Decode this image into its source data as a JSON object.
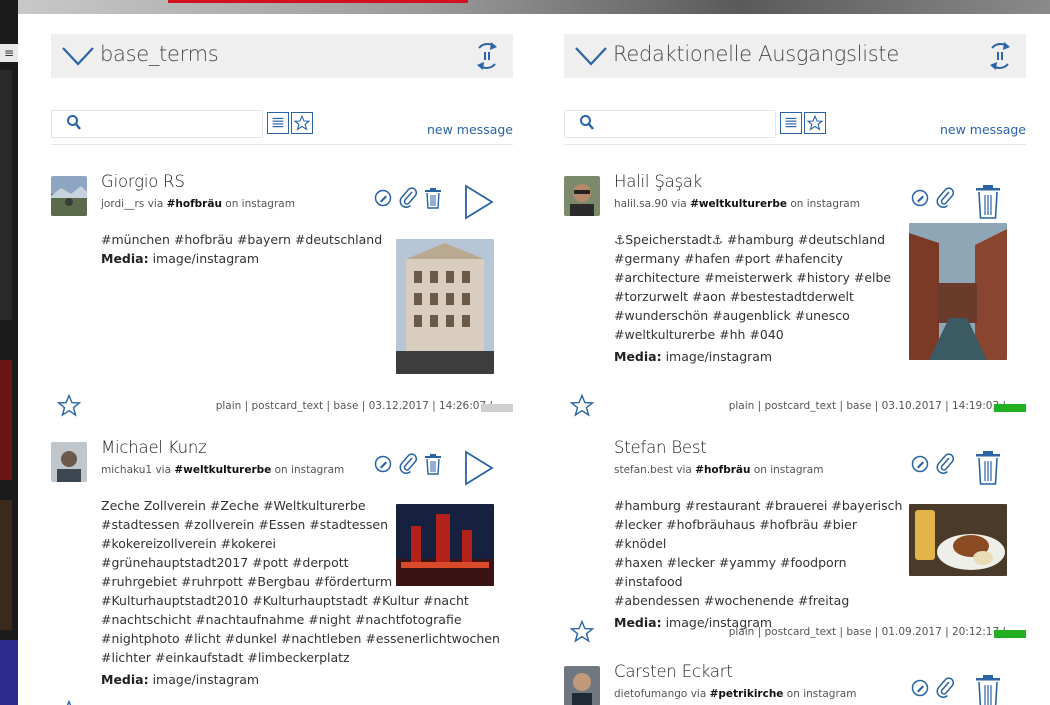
{
  "left_menu_glyph": "≡",
  "columns": [
    {
      "title": "base_terms",
      "search_placeholder": "",
      "new_message": "new message",
      "cards": [
        {
          "name": "Giorgio RS",
          "handle": "jordi__rs",
          "via": "via",
          "tag": "#hofbräu",
          "on": "on instagram",
          "lines": [
            "#münchen #hofbräu #bayern #deutschland"
          ],
          "media_label": "Media:",
          "media_value": "image/instagram",
          "meta": "plain | postcard_text | base | 03.12.2017 | 14:26:07 |",
          "status_color": "#cfcfcf"
        },
        {
          "name": "Michael Kunz",
          "handle": "michaku1",
          "via": "via",
          "tag": "#weltkulturerbe",
          "on": "on instagram",
          "lines": [
            "Zeche Zollverein #Zeche #Weltkulturerbe",
            "#stadtessen #zollverein #Essen #stadtessen",
            "#kokereizollverein #kokerei",
            "#grünehauptstadt2017 #pott #derpott",
            "#ruhrgebiet #ruhrpott #Bergbau #förderturm",
            "#Kulturhauptstadt2010 #Kulturhauptstadt #Kultur #nacht",
            "#nachtschicht #nachtaufnahme #night #nachtfotografie",
            "#nightphoto #licht #dunkel #nachtleben #essenerlichtwochen",
            "#lichter #einkaufstadt #limbeckerplatz"
          ],
          "media_label": "Media:",
          "media_value": "image/instagram"
        }
      ]
    },
    {
      "title": "Redaktionelle Ausgangsliste",
      "search_placeholder": "",
      "new_message": "new message",
      "cards": [
        {
          "name": "Halil Şaşak",
          "handle": "halil.sa.90",
          "via": "via",
          "tag": "#weltkulturerbe",
          "on": "on instagram",
          "lines": [
            "⚓Speicherstadt⚓ #hamburg #deutschland",
            "#germany #hafen #port #hafencity",
            "#architecture #meisterwerk #history #elbe",
            "#torzurwelt #aon #bestestadtderwelt",
            "#wunderschön #augenblick #unesco",
            "#weltkulturerbe #hh #040"
          ],
          "media_label": "Media:",
          "media_value": "image/instagram",
          "meta": "plain | postcard_text | base | 03.10.2017 | 14:19:03 |",
          "status_color": "#22b022"
        },
        {
          "name": "Stefan Best",
          "handle": "stefan.best",
          "via": "via",
          "tag": "#hofbräu",
          "on": "on instagram",
          "lines": [
            "#hamburg #restaurant #brauerei #bayerisch",
            "#lecker #hofbräuhaus #hofbräu #bier #knödel",
            "#haxen #lecker #yammy #foodporn #instafood",
            "#abendessen #wochenende #freitag"
          ],
          "media_label": "Media:",
          "media_value": "image/instagram",
          "meta": "plain | postcard_text | base | 01.09.2017 | 20:12:17 |",
          "status_color": "#22b022"
        },
        {
          "name": "Carsten Eckart",
          "handle": "dietofumango",
          "via": "via",
          "tag": "#petrikirche",
          "on": "on instagram"
        }
      ]
    }
  ],
  "colors": {
    "accent": "#2a63a6",
    "header_bg": "#efefef",
    "status_green": "#22b022",
    "status_grey": "#cfcfcf"
  }
}
